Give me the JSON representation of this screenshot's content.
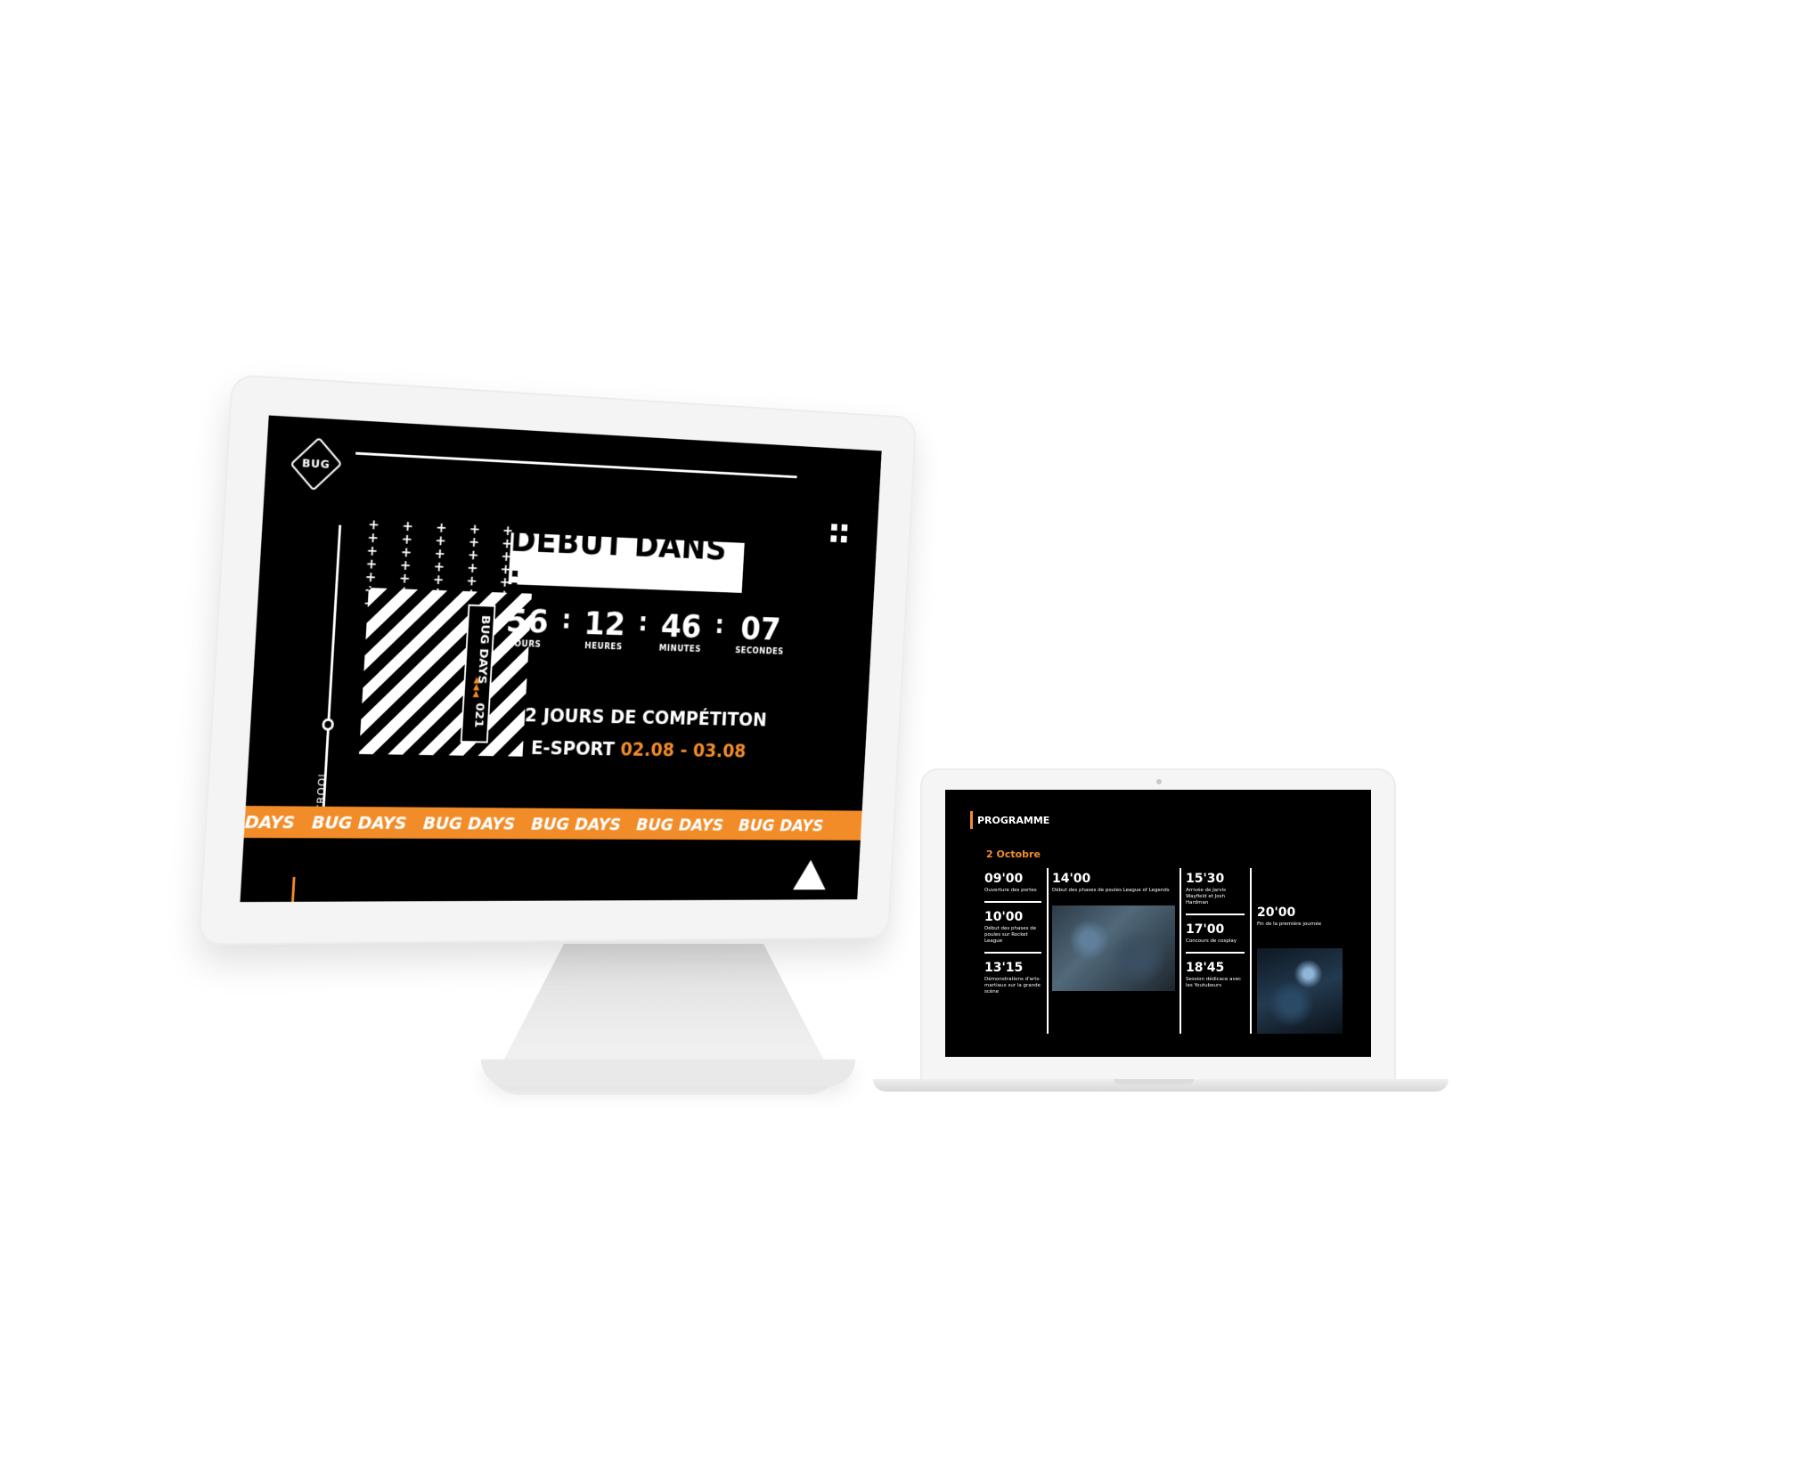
{
  "desktop": {
    "logo_text": "BUG",
    "scroll_label": "SCROOL",
    "plus_pattern": "+ + + + + + + + + + + + + + + + + + + + + + + + + + + + + + + + + +",
    "box_label": "BUG DAYS",
    "box_year": "021",
    "headline": "DÉBUT DANS :",
    "countdown": [
      {
        "value": "56",
        "label": "JOURS"
      },
      {
        "value": "12",
        "label": "HEURES"
      },
      {
        "value": "46",
        "label": "MINUTES"
      },
      {
        "value": "07",
        "label": "SECONDES"
      }
    ],
    "separator": ":",
    "competition_line1": "2 JOURS DE COMPÉTITON",
    "competition_line2_prefix": "E-SPORT",
    "competition_dates": "02.08 - 03.08",
    "marquee_items": [
      "DAYS",
      "BUG DAYS",
      "BUG DAYS",
      "BUG DAYS",
      "BUG DAYS",
      "BUG DAYS"
    ],
    "colors": {
      "accent": "#f28c28",
      "background": "#000000",
      "foreground": "#ffffff"
    }
  },
  "laptop": {
    "section_title": "PROGRAMME",
    "date": "2 Octobre",
    "columns": [
      {
        "slots": [
          {
            "time": "09'00",
            "desc": "Ouverture des portes"
          },
          {
            "time": "10'00",
            "desc": "Début des phases de poules sur Rocket League"
          },
          {
            "time": "13'15",
            "desc": "Démonstrations d'arts-martiaux sur la grande scène"
          }
        ]
      },
      {
        "slots": [
          {
            "time": "14'00",
            "desc": "Début des phases de poules League of Legends"
          }
        ]
      },
      {
        "slots": [
          {
            "time": "15'30",
            "desc": "Arrivée de Jarvis Wayfield et Josh Hardman"
          },
          {
            "time": "17'00",
            "desc": "Concours de cosplay"
          },
          {
            "time": "18'45",
            "desc": "Session dédicace avec les Youtubeurs"
          }
        ]
      },
      {
        "slots": [
          {
            "time": "20'00",
            "desc": "Fin de la première journée"
          }
        ]
      }
    ]
  }
}
